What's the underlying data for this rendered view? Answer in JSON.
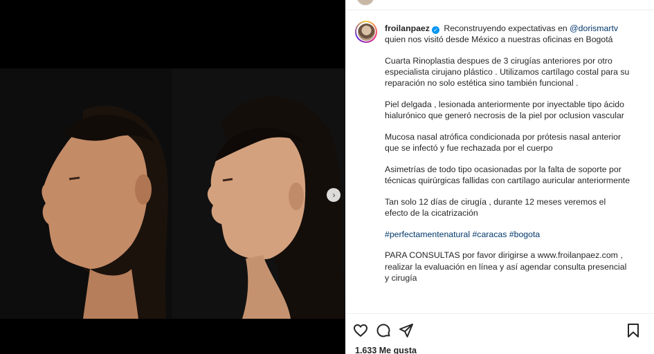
{
  "post": {
    "username": "froilanpaez",
    "verified_label": "✓",
    "paragraphs": {
      "p1_text": " Reconstruyendo expectativas en ",
      "p1_mention": "@dorismartv",
      "p1_rest": " quien nos visitó desde México a nuestras oficinas en Bogotá",
      "p2": "Cuarta Rinoplastia despues de 3 cirugías anteriores por otro especialista cirujano plástico . Utilizamos cartílago costal para su reparación no solo estética sino también funcional .",
      "p3": "Piel delgada , lesionada anteriormente por inyectable tipo ácido hialurónico que generó necrosis de la piel por oclusion vascular",
      "p4": "Mucosa nasal atrófica condicionada por prótesis nasal anterior que se infectó y fue rechazada por el cuerpo",
      "p5": "Asimetrías de todo tipo ocasionadas por la falta de soporte por técnicas quirúrgicas fallidas con cartílago auricular anteriormente",
      "p6": "Tan solo 12 días de cirugía , durante 12 meses veremos el efecto de la cicatrización",
      "hashtags": "#perfectamentenatural #caracas #bogota",
      "p8": "PARA CONSULTAS por favor dirigirse a www.froilanpaez.com , realizar la evaluación en línea y así agendar consulta presencial y cirugía"
    },
    "likes": "1.633 Me gusta"
  },
  "icons": {
    "like": "heart-icon",
    "comment": "comment-icon",
    "share": "share-icon",
    "save": "bookmark-icon",
    "next": "chevron-right-icon"
  },
  "colors": {
    "accent": "#0095f6",
    "link": "#00376b",
    "media_bg": "#000000"
  }
}
